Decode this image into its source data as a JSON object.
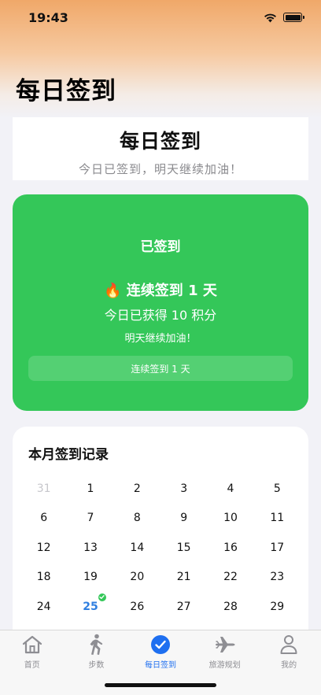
{
  "status_bar": {
    "time": "19:43"
  },
  "page_title": "每日签到",
  "header_card": {
    "title": "每日签到",
    "subtitle": "今日已签到，明天继续加油！"
  },
  "checkin_card": {
    "status": "已签到",
    "streak": "🔥 连续签到 1 天",
    "points": "今日已获得 10 积分",
    "encourage": "明天继续加油！",
    "pill": "连续签到 1 天",
    "color": "#34c759"
  },
  "calendar": {
    "title": "本月签到记录",
    "rows": [
      [
        "31",
        "1",
        "2",
        "3",
        "4",
        "5"
      ],
      [
        "6",
        "7",
        "8",
        "9",
        "10",
        "11"
      ],
      [
        "12",
        "13",
        "14",
        "15",
        "16",
        "17"
      ],
      [
        "18",
        "19",
        "20",
        "21",
        "22",
        "23"
      ],
      [
        "24",
        "25",
        "26",
        "27",
        "28",
        "29"
      ]
    ],
    "muted_day": "31",
    "today": "25",
    "checked_days": [
      "25"
    ],
    "today_color": "#2f7fe0",
    "check_color": "#34c759"
  },
  "tab_bar": {
    "active_color": "#1e6ff0",
    "items": [
      {
        "label": "首页",
        "icon": "house-icon"
      },
      {
        "label": "步数",
        "icon": "walking-person-icon"
      },
      {
        "label": "每日签到",
        "icon": "checkmark-circle-icon",
        "active": true
      },
      {
        "label": "旅游规划",
        "icon": "airplane-icon"
      },
      {
        "label": "我的",
        "icon": "person-icon"
      }
    ]
  }
}
